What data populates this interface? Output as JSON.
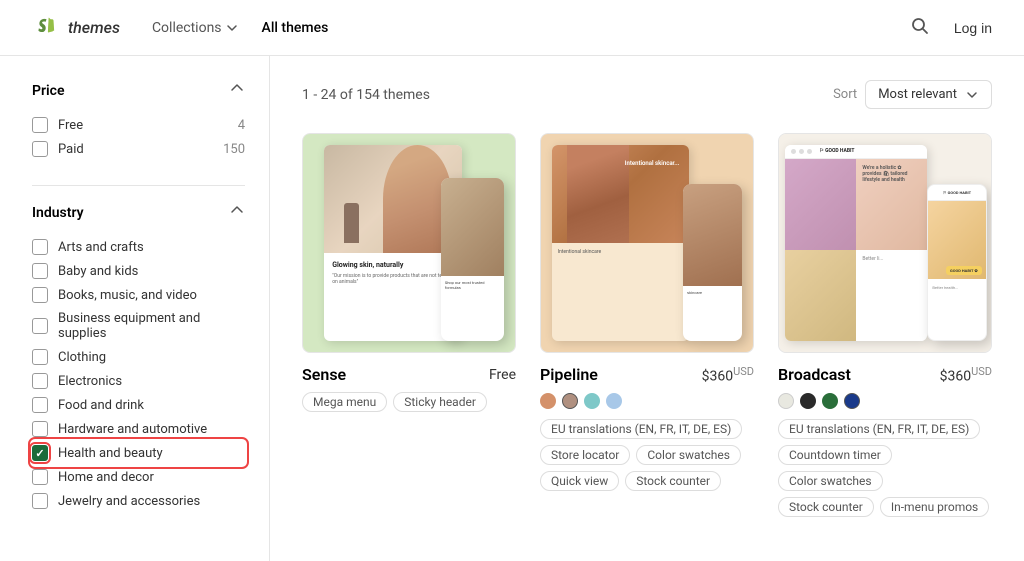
{
  "header": {
    "logo_text": "themes",
    "nav": [
      {
        "label": "Collections",
        "has_dropdown": true,
        "active": false
      },
      {
        "label": "All themes",
        "has_dropdown": false,
        "active": true
      }
    ],
    "login_label": "Log in"
  },
  "sidebar": {
    "price_section": {
      "title": "Price",
      "items": [
        {
          "label": "Free",
          "count": "4",
          "checked": false
        },
        {
          "label": "Paid",
          "count": "150",
          "checked": false
        }
      ]
    },
    "industry_section": {
      "title": "Industry",
      "items": [
        {
          "label": "Arts and crafts",
          "checked": false,
          "highlighted": false
        },
        {
          "label": "Baby and kids",
          "checked": false,
          "highlighted": false
        },
        {
          "label": "Books, music, and video",
          "checked": false,
          "highlighted": false
        },
        {
          "label": "Business equipment and supplies",
          "checked": false,
          "highlighted": false
        },
        {
          "label": "Clothing",
          "checked": false,
          "highlighted": false
        },
        {
          "label": "Electronics",
          "checked": false,
          "highlighted": false
        },
        {
          "label": "Food and drink",
          "checked": false,
          "highlighted": false
        },
        {
          "label": "Hardware and automotive",
          "checked": false,
          "highlighted": false
        },
        {
          "label": "Health and beauty",
          "checked": true,
          "highlighted": true
        },
        {
          "label": "Home and decor",
          "checked": false,
          "highlighted": false
        },
        {
          "label": "Jewelry and accessories",
          "checked": false,
          "highlighted": false
        }
      ]
    }
  },
  "content": {
    "results_count": "1 - 24 of 154 themes",
    "sort": {
      "label": "Sort",
      "selected": "Most relevant"
    },
    "themes": [
      {
        "name": "Sense",
        "price": "Free",
        "price_free": true,
        "swatches": [],
        "tags_row1": [
          "Mega menu",
          "Sticky header"
        ],
        "tags_row2": [],
        "tags_row3": []
      },
      {
        "name": "Pipeline",
        "price": "$360",
        "price_free": false,
        "currency": "USD",
        "swatches": [
          {
            "color": "#d4916a",
            "selected": false
          },
          {
            "color": "#b09080",
            "selected": true
          },
          {
            "color": "#7ec8c8",
            "selected": false
          },
          {
            "color": "#a8c8e8",
            "selected": false
          }
        ],
        "tags_row1": [
          "EU translations (EN, FR, IT, DE, ES)"
        ],
        "tags_row2": [
          "Store locator",
          "Color swatches"
        ],
        "tags_row3": [
          "Quick view",
          "Stock counter"
        ]
      },
      {
        "name": "Broadcast",
        "price": "$360",
        "price_free": false,
        "currency": "USD",
        "swatches": [
          {
            "color": "#e8e8e0",
            "selected": false
          },
          {
            "color": "#2a2a2a",
            "selected": false
          },
          {
            "color": "#2a6e3a",
            "selected": false
          },
          {
            "color": "#1a3a8a",
            "selected": true
          }
        ],
        "tags_row1": [
          "EU translations (EN, FR, IT, DE, ES)"
        ],
        "tags_row2": [
          "Countdown timer",
          "Color swatches"
        ],
        "tags_row3": [
          "Stock counter",
          "In-menu promos"
        ]
      }
    ]
  }
}
